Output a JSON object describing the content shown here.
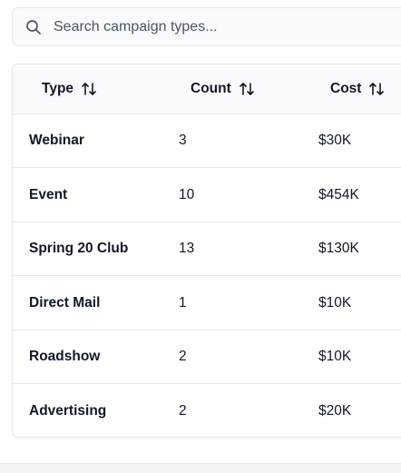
{
  "search": {
    "placeholder": "Search campaign types...",
    "value": "",
    "icon": "search-icon"
  },
  "table": {
    "columns": [
      {
        "label": "Type",
        "sort_icon": "sort-icon"
      },
      {
        "label": "Count",
        "sort_icon": "sort-icon"
      },
      {
        "label": "Cost",
        "sort_icon": "sort-icon"
      }
    ],
    "rows": [
      {
        "type": "Webinar",
        "count": "3",
        "cost": "$30K"
      },
      {
        "type": "Event",
        "count": "10",
        "cost": "$454K"
      },
      {
        "type": "Spring 20 Club",
        "count": "13",
        "cost": "$130K"
      },
      {
        "type": "Direct Mail",
        "count": "1",
        "cost": "$10K"
      },
      {
        "type": "Roadshow",
        "count": "2",
        "cost": "$10K"
      },
      {
        "type": "Advertising",
        "count": "2",
        "cost": "$20K"
      }
    ]
  },
  "colors": {
    "text": "#111827",
    "border": "#e5e7eb",
    "header_bg": "#f9fafb",
    "search_bg": "#f9fafb"
  }
}
